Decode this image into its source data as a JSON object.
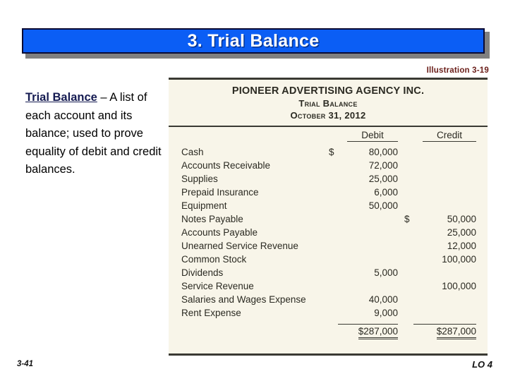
{
  "slide": {
    "title": "3. Trial Balance",
    "illustration_label": "Illustration 3-19",
    "footer_left": "3-41",
    "footer_right": "LO 4",
    "title_bar_color": "#0b5ef5",
    "title_text_color": "#ffffff",
    "illustration_label_color": "#6b1f1a",
    "panel_background": "#f8f5e9"
  },
  "definition": {
    "term": "Trial Balance",
    "dash": " – ",
    "body": "A list of each account and its balance; used to prove equality of debit and credit balances."
  },
  "statement": {
    "company": "PIONEER ADVERTISING AGENCY INC.",
    "title": "Trial Balance",
    "date": "October 31, 2012",
    "columns": [
      "Debit",
      "Credit"
    ],
    "rows": [
      {
        "account": "Cash",
        "debit": "80,000",
        "debit_currency": "$",
        "credit": "",
        "credit_currency": ""
      },
      {
        "account": "Accounts Receivable",
        "debit": "72,000",
        "debit_currency": "",
        "credit": "",
        "credit_currency": ""
      },
      {
        "account": "Supplies",
        "debit": "25,000",
        "debit_currency": "",
        "credit": "",
        "credit_currency": ""
      },
      {
        "account": "Prepaid Insurance",
        "debit": "6,000",
        "debit_currency": "",
        "credit": "",
        "credit_currency": ""
      },
      {
        "account": "Equipment",
        "debit": "50,000",
        "debit_currency": "",
        "credit": "",
        "credit_currency": ""
      },
      {
        "account": "Notes Payable",
        "debit": "",
        "debit_currency": "",
        "credit": "50,000",
        "credit_currency": "$"
      },
      {
        "account": "Accounts Payable",
        "debit": "",
        "debit_currency": "",
        "credit": "25,000",
        "credit_currency": ""
      },
      {
        "account": "Unearned Service Revenue",
        "debit": "",
        "debit_currency": "",
        "credit": "12,000",
        "credit_currency": ""
      },
      {
        "account": "Common Stock",
        "debit": "",
        "debit_currency": "",
        "credit": "100,000",
        "credit_currency": ""
      },
      {
        "account": "Dividends",
        "debit": "5,000",
        "debit_currency": "",
        "credit": "",
        "credit_currency": ""
      },
      {
        "account": "Service Revenue",
        "debit": "",
        "debit_currency": "",
        "credit": "100,000",
        "credit_currency": ""
      },
      {
        "account": "Salaries and Wages Expense",
        "debit": "40,000",
        "debit_currency": "",
        "credit": "",
        "credit_currency": ""
      },
      {
        "account": "Rent Expense",
        "debit": "9,000",
        "debit_currency": "",
        "credit": "",
        "credit_currency": ""
      }
    ],
    "totals": {
      "debit": "$287,000",
      "credit": "$287,000"
    }
  }
}
